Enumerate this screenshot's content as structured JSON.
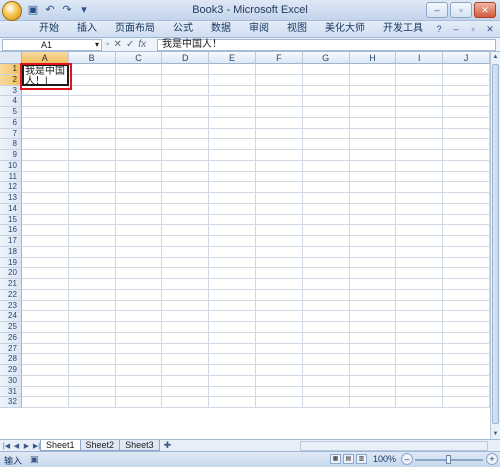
{
  "window": {
    "title": "Book3 - Microsoft Excel",
    "controls": {
      "minimize": "–",
      "restore": "▫",
      "close": "✕"
    }
  },
  "ribbon": {
    "tabs": [
      "开始",
      "插入",
      "页面布局",
      "公式",
      "数据",
      "审阅",
      "视图",
      "美化大师",
      "开发工具"
    ]
  },
  "formula_bar": {
    "name_box": "A1",
    "fx_label": "fx",
    "content": "我是中国人！"
  },
  "columns": [
    "A",
    "B",
    "C",
    "D",
    "E",
    "F",
    "G",
    "H",
    "I",
    "J"
  ],
  "row_count": 32,
  "active_cell": {
    "ref": "A1",
    "value": "我是中国人！",
    "line1": "我是中国",
    "line2": "人！",
    "highlight_color": "#e0141e"
  },
  "sheets": [
    "Sheet1",
    "Sheet2",
    "Sheet3"
  ],
  "active_sheet": "Sheet1",
  "status": {
    "mode": "输入"
  },
  "zoom": {
    "value": "100%"
  }
}
